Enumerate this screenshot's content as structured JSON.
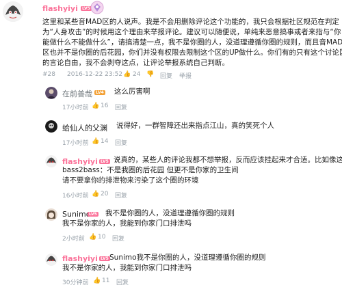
{
  "main_comment": {
    "username": "flashyiyi",
    "level": "LV5",
    "lines": [
      "这里和某些音MAD区的人说声。我是不会用删除评论这个功能的，我只会根据社区规范在判定",
      "为“人身攻击”的时候用这个理由来举报评论。建议可以随便说，单纯来恶意搞事或者来指与“你",
      "能做什么不能做什么”，请搞清楚一点，我不是你圈的人，没道理遵循你圈的规则，而且音MAD",
      "区也并不是你圈的后花园，你们并没有权限去限制这个区的UP做什么。你们有的只有这个讨论区",
      "的言论自由，我不会剥夺这点，让评论举报系统自己判断。"
    ],
    "floor": "#28",
    "datetime": "2016-12-22 23:52",
    "likes": "24"
  },
  "replies": [
    {
      "username": "在前善哉",
      "level": "LV4",
      "lines": [
        "这么厉害啊"
      ],
      "time": "17小时前",
      "likes": "16"
    },
    {
      "username": "蛤仙人的父渊",
      "level": "",
      "lines": [
        "说得好，一群智障还出来指点江山，真的笑死个人"
      ],
      "time": "17小时前",
      "likes": "14"
    },
    {
      "username": "flashyiyi",
      "level": "LV5",
      "lines": [
        "说真的，某些人的评论我都不想举报，反而应该挂起来才合适。比如像这个",
        "bass2bass：不是我圈的后花园 但更不是你家的卫生间",
        "请不要拿你的排泄物来污染了这个圈的环境"
      ],
      "time": "16小时前",
      "likes": "20"
    },
    {
      "username": "Sunimo",
      "level": "LV5",
      "lines": [
        "我不是你圈的人，没道理遵循你圈的规则",
        "我不是你家的人，我能到你家门口排泄吗"
      ],
      "time": "2小时前",
      "likes": "10"
    },
    {
      "username": "flashyiyi",
      "level": "LV5",
      "lines": [
        "Sunimo我不是你圈的人，没道理遵循你圈的规则",
        "我不是你家的人，我能到你家门口排泄吗"
      ],
      "time": "30分钟前",
      "likes": "11"
    }
  ],
  "labels": {
    "reply": "回复",
    "report": "举报"
  },
  "colors": {
    "vip_pink": "#fb7299",
    "meta_gray": "#99a2aa",
    "level_orange": "#f3a034"
  }
}
